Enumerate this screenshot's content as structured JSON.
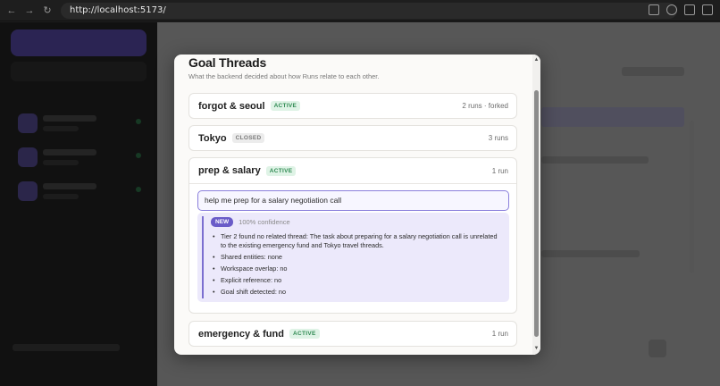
{
  "browser": {
    "url": "http://localhost:5173/"
  },
  "modal": {
    "title": "Goal Threads",
    "subtitle": "What the backend decided about how Runs relate to each other."
  },
  "threads": [
    {
      "name": "forgot & seoul",
      "status": "ACTIVE",
      "meta": "2 runs · forked"
    },
    {
      "name": "Tokyo",
      "status": "CLOSED",
      "meta": "3 runs"
    },
    {
      "name": "prep & salary",
      "status": "ACTIVE",
      "meta": "1 run"
    },
    {
      "name": "emergency & fund",
      "status": "ACTIVE",
      "meta": "1 run"
    }
  ],
  "expanded_thread": {
    "message": "help me prep for a salary negotiation call",
    "decision": {
      "badge": "NEW",
      "confidence": "100% confidence",
      "details": [
        "Tier 2 found no related thread: The task about preparing for a salary negotiation call is unrelated to the existing emergency fund and Tokyo travel threads.",
        "Shared entities: none",
        "Workspace overlap: no",
        "Explicit reference: no",
        "Goal shift detected: no"
      ]
    }
  },
  "colors": {
    "accent": "#6a5cc8",
    "active_badge_bg": "#dff3e6",
    "active_badge_text": "#2f8a52",
    "closed_badge_bg": "#ececec"
  }
}
